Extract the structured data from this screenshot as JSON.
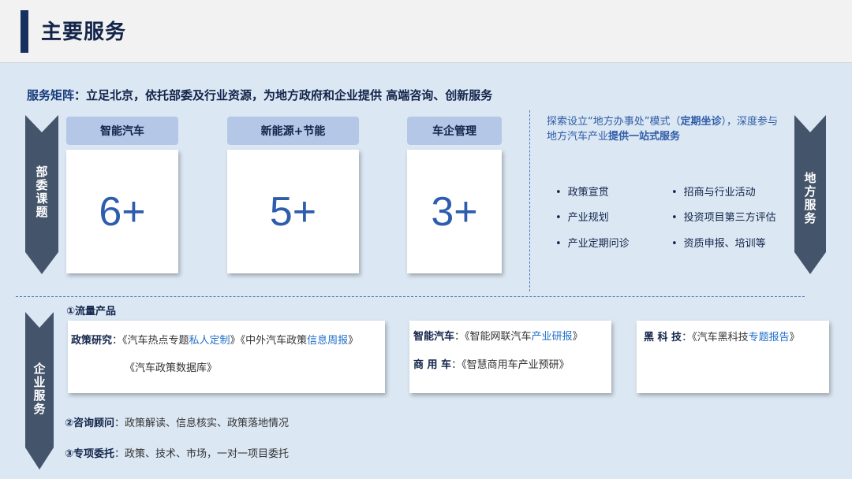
{
  "header": {
    "title": "主要服务"
  },
  "tagline": {
    "lead": "服务矩阵",
    "text": "：立足北京，依托部委及行业资源，为地方政府和企业提供  高端咨询、创新服务"
  },
  "left_arrow_label": [
    "部",
    "委",
    "课",
    "题"
  ],
  "right_arrow_label": [
    "地",
    "方",
    "服",
    "务"
  ],
  "bottom_arrow_label": [
    "企",
    "业",
    "服",
    "务"
  ],
  "categories": [
    {
      "title": "智能汽车",
      "value": "6+"
    },
    {
      "title": "新能源+节能",
      "value": "5+"
    },
    {
      "title": "车企管理",
      "value": "3+"
    }
  ],
  "local_service": {
    "part1": "探索设立“地方办事处”模式（",
    "bold1": "定期坐诊",
    "part2": "），深度参与地方汽车产业",
    "bold2": "提供一站式服务"
  },
  "bullets_left": [
    "政策宣贯",
    "产业规划",
    "产业定期问诊"
  ],
  "bullets_right": [
    "招商与行业活动",
    "投资项目第三方评估",
    "资质申报、培训等"
  ],
  "flow_products": {
    "heading": "①流量产品",
    "policy_label": "政策研究",
    "policy_sep": "：",
    "policy_line1_a": "《汽车热点专题",
    "policy_line1_b": "私人定制",
    "policy_line1_c": "》《中外汽车政策",
    "policy_line1_d": "信息周报",
    "policy_line1_e": "》",
    "policy_line2": "《汽车政策数据库》",
    "smart_label": "智能汽车",
    "smart_sep": "：",
    "smart_a": "《智能网联汽车",
    "smart_b": "产业研报",
    "smart_c": "》",
    "commercial_label": "商 用 车",
    "commercial_sep": "：",
    "commercial_text": "《智慧商用车产业预研》",
    "blacktech_label": "黑 科 技",
    "blacktech_sep": "：",
    "blacktech_a": "《汽车黑科技",
    "blacktech_b": "专题报告",
    "blacktech_c": "》"
  },
  "consulting": {
    "label": "②咨询顾问",
    "text": "：政策解读、信息核实、政策落地情况"
  },
  "special": {
    "label": "③专项委托",
    "text": "：政策、技术、市场，一对一项目委托"
  },
  "colors": {
    "arrow": "#44546a",
    "accent": "#16305f",
    "highlight": "#1f6fc8",
    "card_head": "#b4c7e7"
  }
}
